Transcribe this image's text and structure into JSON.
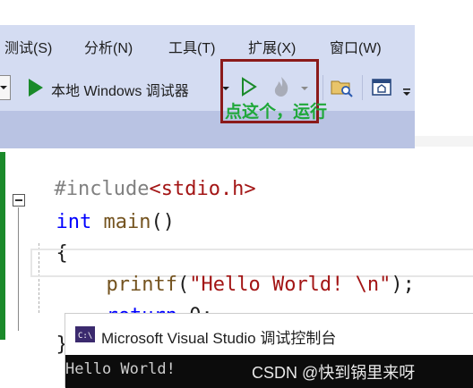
{
  "menu": {
    "items": [
      {
        "label": "测试(S)"
      },
      {
        "label": "分析(N)"
      },
      {
        "label": "工具(T)"
      },
      {
        "label": "扩展(X)"
      },
      {
        "label": "窗口(W)"
      }
    ]
  },
  "toolbar": {
    "debugger_label": "本地 Windows 调试器"
  },
  "annotation": {
    "text": "点这个，运行",
    "box_color": "#8b1a1a",
    "text_color": "#1fa83a"
  },
  "editor": {
    "lines": {
      "include": {
        "directive": "#include",
        "header": "<stdio.h>"
      },
      "main": {
        "type": "int",
        "name": "main",
        "parens": "()"
      },
      "open_brace": "{",
      "printf": {
        "fn": "printf",
        "open": "(",
        "str": "\"Hello World! \\n\"",
        "close": ");"
      },
      "return": {
        "kw": "return",
        "value": " 0;"
      },
      "close_brace": "}"
    }
  },
  "console": {
    "title": "Microsoft Visual Studio 调试控制台",
    "output": "Hello World!",
    "watermark": "CSDN @快到锅里来呀"
  }
}
